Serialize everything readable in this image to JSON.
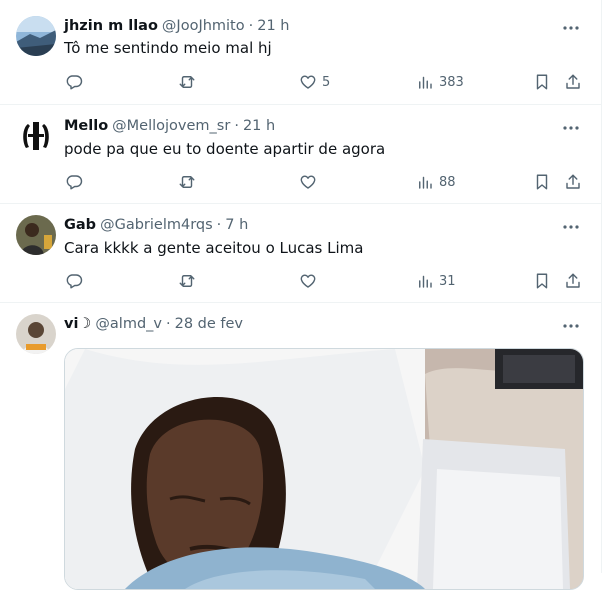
{
  "posts": [
    {
      "name": "jhzin m llao",
      "handle": "@JooJhmito",
      "time": "21 h",
      "text": "Tô me sentindo meio mal hj",
      "likes": "5",
      "views": "383"
    },
    {
      "name": "Mello",
      "handle": "@Mellojovem_sr",
      "time": "21 h",
      "text": "pode pa que eu to doente apartir de agora",
      "likes": "",
      "views": "88"
    },
    {
      "name": "Gab",
      "handle": "@Gabrielm4rqs",
      "time": "7 h",
      "text": "Cara kkkk a gente aceitou o Lucas Lima",
      "likes": "",
      "views": "31"
    },
    {
      "name": "vi☽",
      "handle": "@almd_v",
      "time": "28 de fev",
      "text": "",
      "likes": "",
      "views": ""
    }
  ],
  "separator": "·",
  "icons": {
    "reply": "reply-icon",
    "repost": "repost-icon",
    "like": "heart-icon",
    "views": "views-chart-icon",
    "bookmark": "bookmark-icon",
    "share": "share-icon",
    "more": "more-dots-icon"
  },
  "colors": {
    "text": "#0f1419",
    "secondary": "#536471",
    "border": "#eff3f4"
  }
}
